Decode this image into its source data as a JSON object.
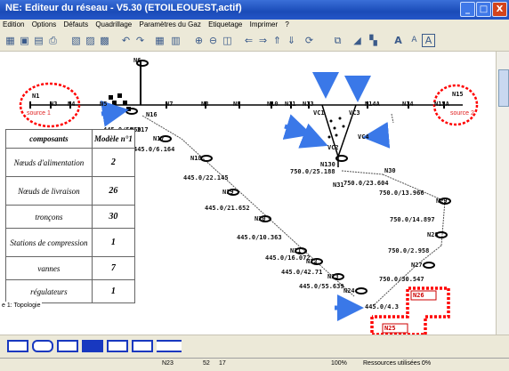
{
  "window": {
    "title": "NE: Editeur du réseau - V5.30 (ETOILEOUEST,actif)",
    "buttons": [
      "_",
      "□",
      "X"
    ]
  },
  "menu": [
    "Edition",
    "Options",
    "Défauts",
    "Quadrillage",
    "Paramètres du Gaz",
    "Etiquetage",
    "Imprimer",
    "?"
  ],
  "toolbar": {
    "icons": [
      "grid-icon",
      "save-icon",
      "copy-icon",
      "print-icon",
      "cut-icon",
      "paste-icon",
      "delete-icon",
      "undo-icon",
      "redo-icon",
      "table-icon",
      "grid-view-icon",
      "zoom-in-icon",
      "zoom-out-icon",
      "zoom-fit-icon",
      "arrow-left-icon",
      "arrow-right-icon",
      "arrow-up-icon",
      "arrow-down-icon",
      "refresh-icon",
      "node-icon",
      "chart-icon",
      "layout-icon",
      "font-bigger-icon",
      "font-smaller-icon",
      "text-box-icon"
    ],
    "labels": [
      "A",
      "A",
      "A"
    ]
  },
  "nodes": [
    "N6",
    "N1",
    "N3",
    "N4",
    "N5",
    "N7",
    "N8",
    "N9",
    "N10",
    "N11",
    "N13",
    "N14A",
    "N14",
    "N15A",
    "N15",
    "N16",
    "N17",
    "N18",
    "N19",
    "N20",
    "N21",
    "N22",
    "N23",
    "N24",
    "N25",
    "N26",
    "N27",
    "N28",
    "N29",
    "N30",
    "N31",
    "N130",
    "VC1",
    "VC2",
    "VC3",
    "VC4",
    "N50"
  ],
  "sources": [
    "source 1",
    "source 2"
  ],
  "pipe_labels": [
    "445.0/50.317",
    "445.0/6.164",
    "445.0/22.145",
    "445.0/21.652",
    "445.0/10.363",
    "445.0/16.072",
    "445.0/42.71",
    "445.0/55.639",
    "445.0/4.3",
    "750.0/25.188",
    "750.0/23.604",
    "750.0/13.966",
    "750.0/14.897",
    "750.0/2.958",
    "750.0/30.547"
  ],
  "table": {
    "headers": [
      "composants",
      "Modèle n°1"
    ],
    "rows": [
      {
        "label": "Nœuds d'alimentation",
        "value": "2"
      },
      {
        "label": "Nœuds de livraison",
        "value": "26"
      },
      {
        "label": "tronçons",
        "value": "30"
      },
      {
        "label": "Stations de compression",
        "value": "1"
      },
      {
        "label": "vannes",
        "value": "7"
      },
      {
        "label": "régulateurs",
        "value": "1"
      }
    ]
  },
  "caption": "e 1:  Topologie",
  "status": {
    "node": "N23",
    "x": "52",
    "y": "17",
    "zoom": "100%",
    "resources_label": "Ressources utilisées :",
    "resources_value": "0%"
  },
  "colors": {
    "annotation": "#ff0000",
    "arrow": "#3a78e8",
    "pipe": "#000000",
    "titlebar": "#1a4bb8",
    "bottom_tool": "#1838c0"
  }
}
